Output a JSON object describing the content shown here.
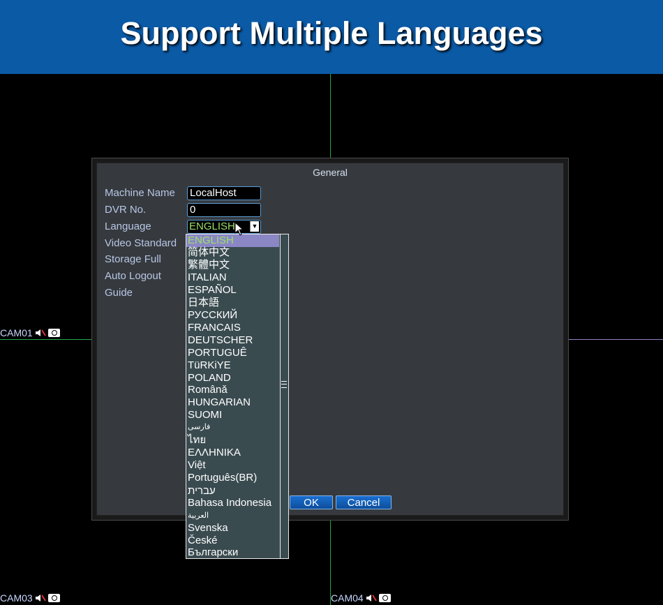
{
  "banner": {
    "title": "Support Multiple Languages"
  },
  "cameras": [
    {
      "label": "CAM01"
    },
    {
      "label": "CAM03"
    },
    {
      "label": "CAM04"
    }
  ],
  "dialog": {
    "title": "General",
    "fields": [
      {
        "label": "Machine Name"
      },
      {
        "label": "DVR No."
      },
      {
        "label": "Language"
      },
      {
        "label": "Video Standard"
      },
      {
        "label": "Storage Full"
      },
      {
        "label": "Auto Logout"
      },
      {
        "label": "Guide"
      }
    ],
    "machine_name_value": "LocalHost",
    "dvr_no_value": "0",
    "language_value": "ENGLISH",
    "ok_label": "OK",
    "cancel_label": "Cancel"
  },
  "language_dropdown": {
    "selected": "ENGLISH",
    "options": [
      "ENGLISH",
      "简体中文",
      "繁體中文",
      "ITALIAN",
      "ESPAÑOL",
      "日本語",
      "РУССКИЙ",
      "FRANCAIS",
      "DEUTSCHER",
      "PORTUGUÊ",
      "TüRKiYE",
      "POLAND",
      "Românǎ",
      "HUNGARIAN",
      "SUOMI",
      "فارسی",
      "ไทย",
      "ΕΛΛΗΝΙΚΑ",
      "Việt",
      "Português(BR)",
      "עברית",
      "Bahasa Indonesia",
      "العربية",
      "Svenska",
      "České",
      "Български"
    ]
  },
  "colors": {
    "banner": "#0b5aa6",
    "dialog_bg": "#363a3e",
    "input_border": "#5b9ed8",
    "selected_text": "#9be06a",
    "selected_bg": "#8b87c5",
    "dropdown_bg": "#3a4b50",
    "grid_green": "#1fa84a",
    "grid_purple": "#9a7fc7"
  },
  "icons": [
    "speaker-icon",
    "camera-icon",
    "mouse-cursor-icon",
    "dropdown-arrow-icon"
  ]
}
